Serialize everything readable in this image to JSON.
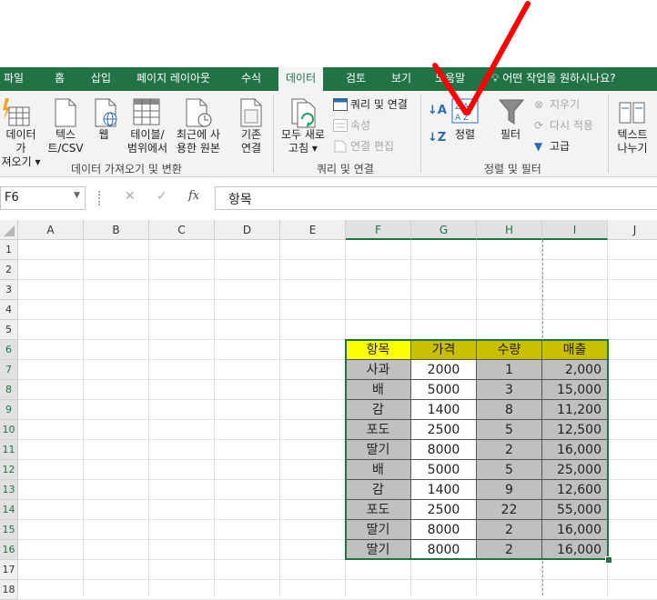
{
  "ribbon_tabs": [
    "파일",
    "홈",
    "삽입",
    "페이지 레이아웃",
    "수식",
    "데이터",
    "검토",
    "보기",
    "도움말"
  ],
  "tell_me": "어떤 작업을 원하시나요?",
  "ribbon": {
    "get_data": "데이터 가\n져오기 ▾",
    "text_csv": "텍스\n트/CSV",
    "web": "웹",
    "from_table": "테이블/\n범위에서",
    "recent_sources": "최근에 사\n용한 원본",
    "existing_conn": "기존\n연결",
    "refresh_all": "모두 새로\n고침 ▾",
    "queries_conn": "쿼리 및 연결",
    "properties": "속성",
    "edit_links": "연결 편집",
    "sort_az": "",
    "sort": "정렬",
    "filter": "필터",
    "clear": "지우기",
    "reapply": "다시 적용",
    "advanced": "고급",
    "text_to_columns": "텍스트\n나누기",
    "group_get_transform": "데이터 가져오기 및 변환",
    "group_queries": "쿼리 및 연결",
    "group_sort_filter": "정렬 및 필터"
  },
  "formula_bar": {
    "name_box": "F6",
    "fx": "fx",
    "content": "항목"
  },
  "columns": [
    "A",
    "B",
    "C",
    "D",
    "E",
    "F",
    "G",
    "H",
    "I",
    "J"
  ],
  "rows": [
    "1",
    "2",
    "3",
    "4",
    "5",
    "6",
    "7",
    "8",
    "9",
    "10",
    "11",
    "12",
    "13",
    "14",
    "15",
    "16",
    "17",
    "18"
  ],
  "table": {
    "headers": [
      "항목",
      "가격",
      "수량",
      "매출"
    ],
    "rows": [
      [
        "사과",
        "2000",
        "1",
        "2,000"
      ],
      [
        "배",
        "5000",
        "3",
        "15,000"
      ],
      [
        "감",
        "1400",
        "8",
        "11,200"
      ],
      [
        "포도",
        "2500",
        "5",
        "12,500"
      ],
      [
        "딸기",
        "8000",
        "2",
        "16,000"
      ],
      [
        "배",
        "5000",
        "5",
        "25,000"
      ],
      [
        "감",
        "1400",
        "9",
        "12,600"
      ],
      [
        "포도",
        "2500",
        "22",
        "55,000"
      ],
      [
        "딸기",
        "8000",
        "2",
        "16,000"
      ],
      [
        "딸기",
        "8000",
        "2",
        "16,000"
      ]
    ]
  },
  "colors": {
    "excel_green": "#217346",
    "header_yellow": "#ffff00",
    "header_olive": "#c9bf00",
    "body_gray": "#c0c0c0",
    "annotation_red": "#ff0000"
  }
}
